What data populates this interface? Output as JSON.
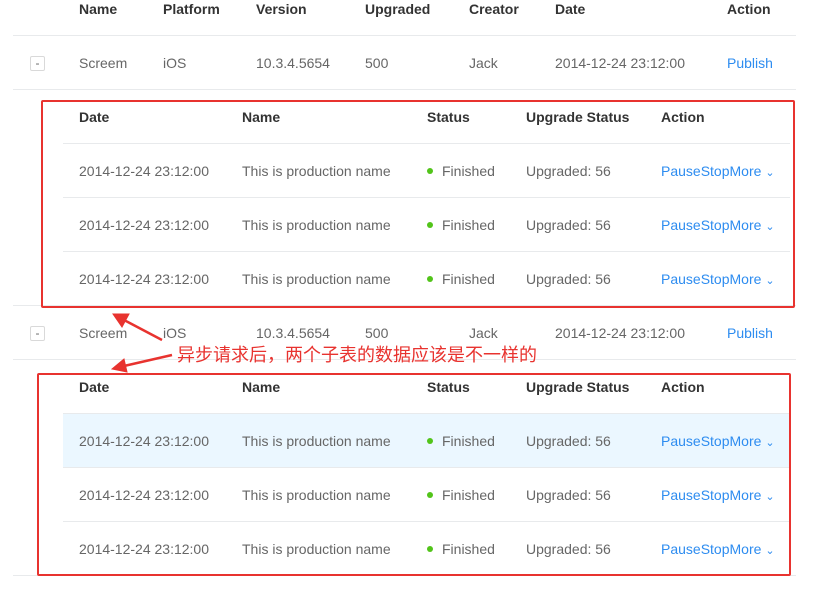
{
  "outer_header": {
    "name": "Name",
    "platform": "Platform",
    "version": "Version",
    "upgraded": "Upgraded",
    "creator": "Creator",
    "date": "Date",
    "action": "Action"
  },
  "rows": [
    {
      "expand": "-",
      "name": "Screem",
      "platform": "iOS",
      "version": "10.3.4.5654",
      "upgraded": "500",
      "creator": "Jack",
      "date": "2014-12-24 23:12:00",
      "action": "Publish",
      "sub_header": {
        "date": "Date",
        "name": "Name",
        "status": "Status",
        "upgrade_status": "Upgrade Status",
        "action": "Action"
      },
      "sub_rows": [
        {
          "date": "2014-12-24 23:12:00",
          "name": "This is production name",
          "status": "Finished",
          "upgrade_status": "Upgraded: 56",
          "pause": "Pause",
          "stop": "Stop",
          "more": "More"
        },
        {
          "date": "2014-12-24 23:12:00",
          "name": "This is production name",
          "status": "Finished",
          "upgrade_status": "Upgraded: 56",
          "pause": "Pause",
          "stop": "Stop",
          "more": "More"
        },
        {
          "date": "2014-12-24 23:12:00",
          "name": "This is production name",
          "status": "Finished",
          "upgrade_status": "Upgraded: 56",
          "pause": "Pause",
          "stop": "Stop",
          "more": "More"
        }
      ]
    },
    {
      "expand": "-",
      "name": "Screem",
      "platform": "iOS",
      "version": "10.3.4.5654",
      "upgraded": "500",
      "creator": "Jack",
      "date": "2014-12-24 23:12:00",
      "action": "Publish",
      "sub_header": {
        "date": "Date",
        "name": "Name",
        "status": "Status",
        "upgrade_status": "Upgrade Status",
        "action": "Action"
      },
      "sub_rows": [
        {
          "date": "2014-12-24 23:12:00",
          "name": "This is production name",
          "status": "Finished",
          "upgrade_status": "Upgraded: 56",
          "pause": "Pause",
          "stop": "Stop",
          "more": "More"
        },
        {
          "date": "2014-12-24 23:12:00",
          "name": "This is production name",
          "status": "Finished",
          "upgrade_status": "Upgraded: 56",
          "pause": "Pause",
          "stop": "Stop",
          "more": "More"
        },
        {
          "date": "2014-12-24 23:12:00",
          "name": "This is production name",
          "status": "Finished",
          "upgrade_status": "Upgraded: 56",
          "pause": "Pause",
          "stop": "Stop",
          "more": "More"
        }
      ]
    }
  ],
  "annotation": {
    "text": "异步请求后，两个子表的数据应该是不一样的",
    "color": "#e8332f"
  },
  "colors": {
    "link": "#2d8cf0",
    "status_finished": "#52c41a",
    "row_hover": "#ebf7ff"
  }
}
